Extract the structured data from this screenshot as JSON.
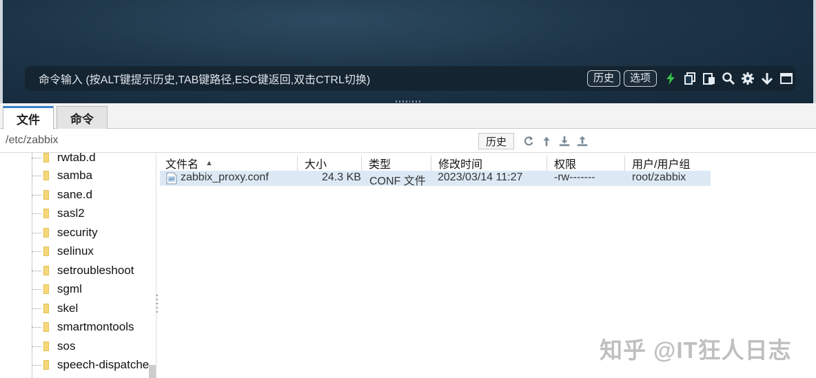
{
  "terminal": {
    "command_placeholder": "命令输入 (按ALT键提示历史,TAB键路径,ESC键返回,双击CTRL切换)",
    "history_button": "历史",
    "options_button": "选项",
    "icons": [
      "lightning-icon",
      "copy-icon",
      "paste-icon",
      "search-icon",
      "gear-icon",
      "download-arrow-icon",
      "maximize-icon"
    ]
  },
  "tabs": [
    {
      "label": "文件",
      "active": true
    },
    {
      "label": "命令",
      "active": false
    }
  ],
  "pathbar": {
    "path": "/etc/zabbix",
    "history_button": "历史",
    "icons": [
      "refresh-icon",
      "up-dir-icon",
      "download-icon",
      "upload-icon"
    ]
  },
  "tree": {
    "items": [
      "rwtab.d",
      "samba",
      "sane.d",
      "sasl2",
      "security",
      "selinux",
      "setroubleshoot",
      "sgml",
      "skel",
      "smartmontools",
      "sos",
      "speech-dispatche"
    ]
  },
  "filelist": {
    "columns": [
      "文件名",
      "大小",
      "类型",
      "修改时间",
      "权限",
      "用户/用户组"
    ],
    "sort_column": "文件名",
    "sort_direction": "ascending",
    "rows": [
      {
        "name": "zabbix_proxy.conf",
        "size": "24.3 KB",
        "type": "CONF 文件",
        "modified": "2023/03/14 11:27",
        "permissions": "-rw-------",
        "owner": "root/zabbix"
      }
    ]
  },
  "watermark": "知乎 @IT狂人日志",
  "colors": {
    "accent_tab": "#3a7fc9",
    "selected_row": "#dce9f5",
    "lightning": "#35c14b",
    "folder": "#f6d879"
  }
}
